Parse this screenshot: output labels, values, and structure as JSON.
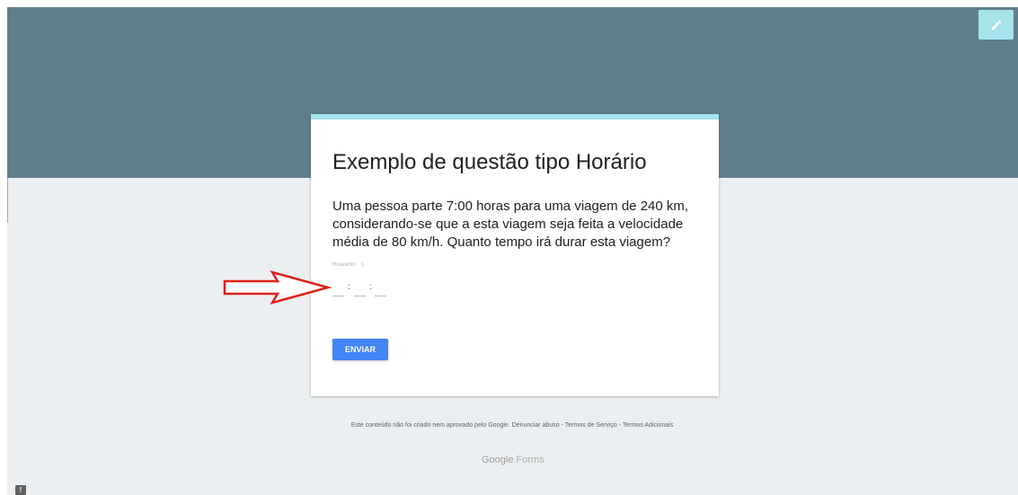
{
  "colors": {
    "header": "#607d8b",
    "background": "#eceff1",
    "accent": "#a6e3ec",
    "submit": "#4285f4",
    "annotation_arrow": "#e0201b"
  },
  "toolbar": {
    "edit_icon": "pencil-icon"
  },
  "form": {
    "title": "Exemplo de questão tipo Horário",
    "question": "Uma pessoa parte 7:00 horas para uma viagem de 240 km, considerando-se que a esta viagem seja feita a velocidade média de 80 km/h. Quanto tempo irá durar esta viagem?",
    "time_labels": {
      "hours": "Horas",
      "minutes": "min",
      "seconds": "s"
    },
    "separator": ":",
    "submit_label": "ENVIAR"
  },
  "footer": {
    "disclaimer": "Este conteúdo não foi criado nem aprovado pelo Google.",
    "report_link": "Denunciar abuso",
    "sep1": "-",
    "terms_link": "Termos de Serviço",
    "sep2": "-",
    "additional_link": "Termos Adicionais",
    "brand_google": "Google",
    "brand_forms": "Forms"
  },
  "report_button": {
    "label": "!"
  }
}
